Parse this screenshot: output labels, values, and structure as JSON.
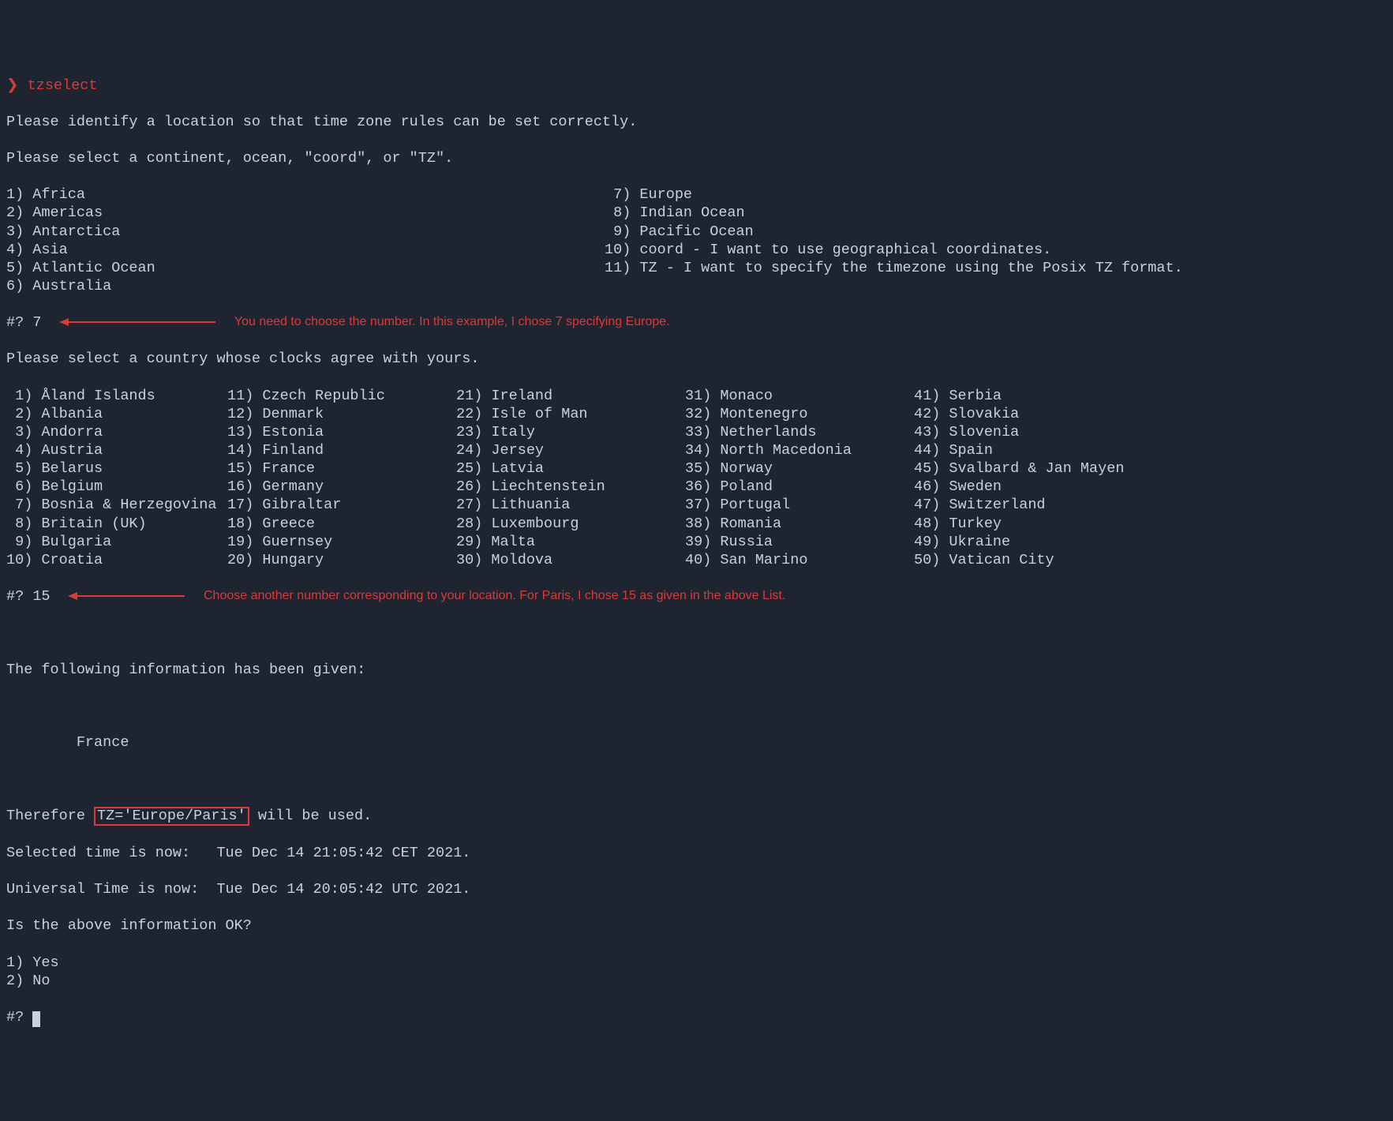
{
  "prompt_chevron": "❯",
  "command": "tzselect",
  "intro_line1": "Please identify a location so that time zone rules can be set correctly.",
  "intro_line2": "Please select a continent, ocean, \"coord\", or \"TZ\".",
  "continents_col1": [
    "1) Africa",
    "2) Americas",
    "3) Antarctica",
    "4) Asia",
    "5) Atlantic Ocean",
    "6) Australia"
  ],
  "continents_col2": [
    " 7) Europe",
    " 8) Indian Ocean",
    " 9) Pacific Ocean",
    "10) coord - I want to use geographical coordinates.",
    "11) TZ - I want to specify the timezone using the Posix TZ format."
  ],
  "input1_prompt": "#?",
  "input1_value": "7",
  "annotation1": "You need to choose the number. In this example, I chose 7 specifying Europe.",
  "country_prompt": "Please select a country whose clocks agree with yours.",
  "countries": [
    [
      " 1) Åland Islands",
      "11) Czech Republic",
      "21) Ireland",
      "31) Monaco",
      "41) Serbia"
    ],
    [
      " 2) Albania",
      "12) Denmark",
      "22) Isle of Man",
      "32) Montenegro",
      "42) Slovakia"
    ],
    [
      " 3) Andorra",
      "13) Estonia",
      "23) Italy",
      "33) Netherlands",
      "43) Slovenia"
    ],
    [
      " 4) Austria",
      "14) Finland",
      "24) Jersey",
      "34) North Macedonia",
      "44) Spain"
    ],
    [
      " 5) Belarus",
      "15) France",
      "25) Latvia",
      "35) Norway",
      "45) Svalbard & Jan Mayen"
    ],
    [
      " 6) Belgium",
      "16) Germany",
      "26) Liechtenstein",
      "36) Poland",
      "46) Sweden"
    ],
    [
      " 7) Bosnia & Herzegovina",
      "17) Gibraltar",
      "27) Lithuania",
      "37) Portugal",
      "47) Switzerland"
    ],
    [
      " 8) Britain (UK)",
      "18) Greece",
      "28) Luxembourg",
      "38) Romania",
      "48) Turkey"
    ],
    [
      " 9) Bulgaria",
      "19) Guernsey",
      "29) Malta",
      "39) Russia",
      "49) Ukraine"
    ],
    [
      "10) Croatia",
      "20) Hungary",
      "30) Moldova",
      "40) San Marino",
      "50) Vatican City"
    ]
  ],
  "input2_prompt": "#?",
  "input2_value": "15",
  "annotation2": "Choose another number corresponding to your location. For Paris, I chose 15 as given in the above List.",
  "info_heading": "The following information has been given:",
  "info_country": "France",
  "therefore_prefix": "Therefore ",
  "tz_value": "TZ='Europe/Paris'",
  "therefore_suffix": " will be used.",
  "selected_time_line": "Selected time is now:   Tue Dec 14 21:05:42 CET 2021.",
  "universal_time_line": "Universal Time is now:  Tue Dec 14 20:05:42 UTC 2021.",
  "confirm_prompt": "Is the above information OK?",
  "confirm_options": [
    "1) Yes",
    "2) No"
  ],
  "input3_prompt": "#?"
}
